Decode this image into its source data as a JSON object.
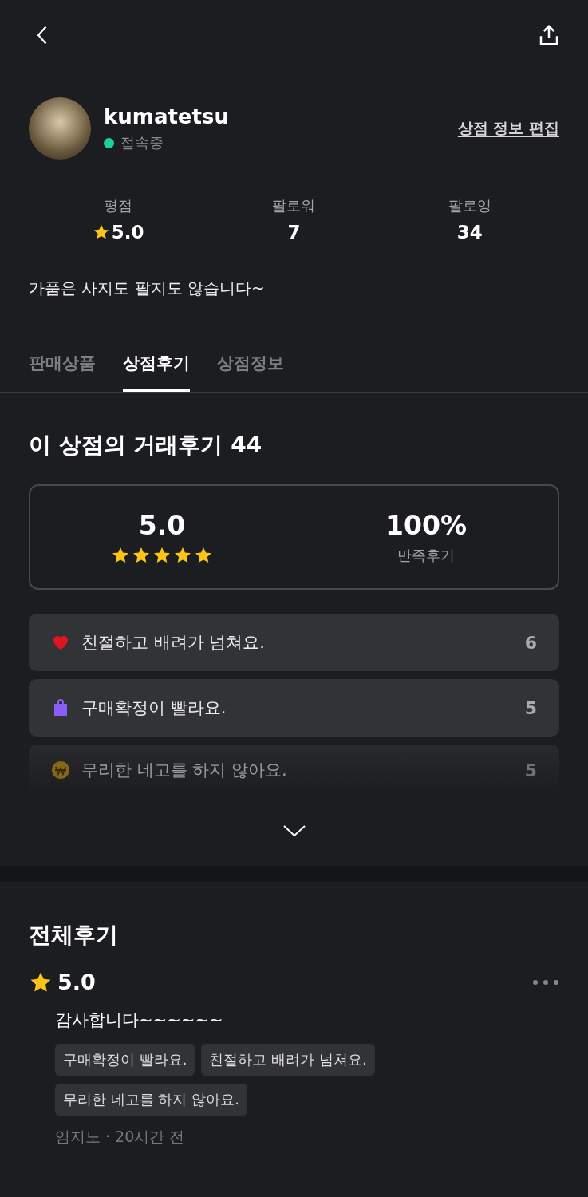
{
  "profile": {
    "name": "kumatetsu",
    "status": "접속중",
    "edit_link": "상점 정보 편집"
  },
  "stats": [
    {
      "label": "평점",
      "value": "5.0",
      "kind": "rating"
    },
    {
      "label": "팔로워",
      "value": "7",
      "kind": "plain"
    },
    {
      "label": "팔로잉",
      "value": "34",
      "kind": "plain"
    }
  ],
  "bio": "가품은 사지도 팔지도 않습니다~",
  "tabs": [
    {
      "label": "판매상품",
      "selected": false
    },
    {
      "label": "상점후기",
      "selected": true
    },
    {
      "label": "상점정보",
      "selected": false
    }
  ],
  "review_summary": {
    "title": "이 상점의 거래후기 44",
    "score": "5.0",
    "stars": 5,
    "satisfaction": "100%",
    "satisfaction_label": "만족후기"
  },
  "feedback": [
    {
      "kind": "heart",
      "text": "친절하고 배려가 넘쳐요.",
      "count": "6",
      "faded": false
    },
    {
      "kind": "bag",
      "text": "구매확정이 빨라요.",
      "count": "5",
      "faded": false
    },
    {
      "kind": "won",
      "text": "무리한 네고를 하지 않아요.",
      "count": "5",
      "faded": true
    }
  ],
  "all_reviews": {
    "title": "전체후기",
    "reviews": [
      {
        "score": "5.0",
        "text": "감사합니다~~~~~~",
        "tags": [
          "구매확정이 빨라요.",
          "친절하고 배려가 넘쳐요.",
          "무리한 네고를 하지 않아요."
        ],
        "meta": "임지노 · 20시간 전"
      }
    ]
  }
}
